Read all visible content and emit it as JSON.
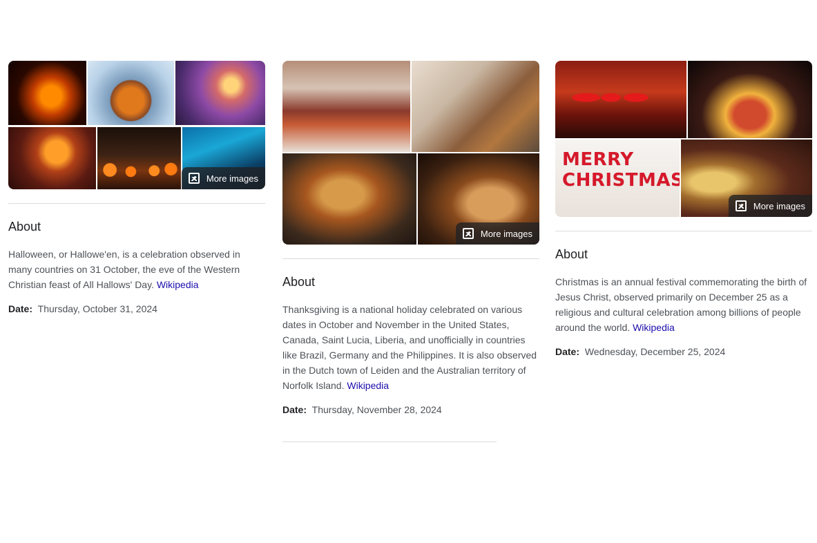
{
  "cards": [
    {
      "id": "halloween",
      "about_heading": "About",
      "description": "Halloween, or Hallowe'en, is a celebration observed in many countries on 31 October, the eve of the Western Christian feast of All Hallows' Day.",
      "source_link": "Wikipedia",
      "date_label": "Date:",
      "date_value": "Thursday, October 31, 2024",
      "more_images_label": "More images"
    },
    {
      "id": "thanksgiving",
      "about_heading": "About",
      "description": "Thanksgiving is a national holiday celebrated on various dates in October and November in the United States, Canada, Saint Lucia, Liberia, and unofficially in countries like Brazil, Germany and the Philippines. It is also observed in the Dutch town of Leiden and the Australian territory of Norfolk Island.",
      "source_link": "Wikipedia",
      "date_label": "Date:",
      "date_value": "Thursday, November 28, 2024",
      "more_images_label": "More images"
    },
    {
      "id": "christmas",
      "about_heading": "About",
      "description": "Christmas is an annual festival commemorating the birth of Jesus Christ, observed primarily on December 25 as a religious and cultural celebration among billions of people around the world.",
      "source_link": "Wikipedia",
      "date_label": "Date:",
      "date_value": "Wednesday, December 25, 2024",
      "more_images_label": "More images",
      "image_text": [
        "MERRY",
        "CHRISTMAS"
      ]
    }
  ],
  "colors": {
    "link": "#1a0dab",
    "text": "#4d5156",
    "heading": "#202124",
    "divider": "#dadce0"
  },
  "icons": {
    "more_images": "image-icon"
  }
}
